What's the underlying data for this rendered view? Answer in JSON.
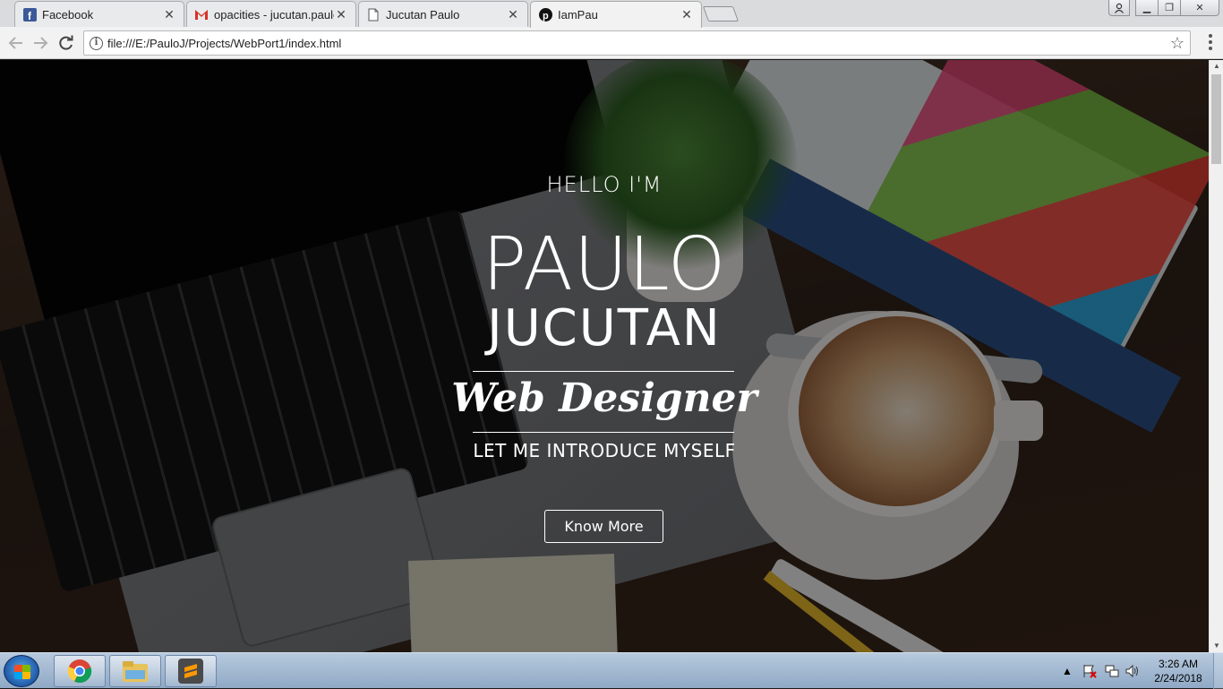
{
  "browser": {
    "tabs": [
      {
        "title": "Facebook",
        "icon": "facebook-icon",
        "active": false
      },
      {
        "title": "opacities - jucutan.paulo",
        "icon": "gmail-icon",
        "active": false
      },
      {
        "title": "Jucutan Paulo",
        "icon": "document-icon",
        "active": false
      },
      {
        "title": "IamPau",
        "icon": "pinterest-icon",
        "active": true
      }
    ],
    "close_glyph": "✕",
    "url": "file:///E:/PauloJ/Projects/WebPort1/index.html",
    "info_glyph": "i",
    "star_glyph": "☆",
    "window_controls": {
      "minimize": "▁",
      "maximize": "❐",
      "close": "✕"
    }
  },
  "page": {
    "hello": "HELLO I'M",
    "first_name": "PAULO",
    "last_name": "JUCUTAN",
    "role": "Web Designer",
    "tagline": "LET ME INTRODUCE MYSELF",
    "cta": "Know More"
  },
  "taskbar": {
    "apps": [
      "chrome-icon",
      "file-explorer-icon",
      "sublime-text-icon"
    ],
    "time": "3:26 AM",
    "date": "2/24/2018",
    "tray_arrow": "▲"
  }
}
